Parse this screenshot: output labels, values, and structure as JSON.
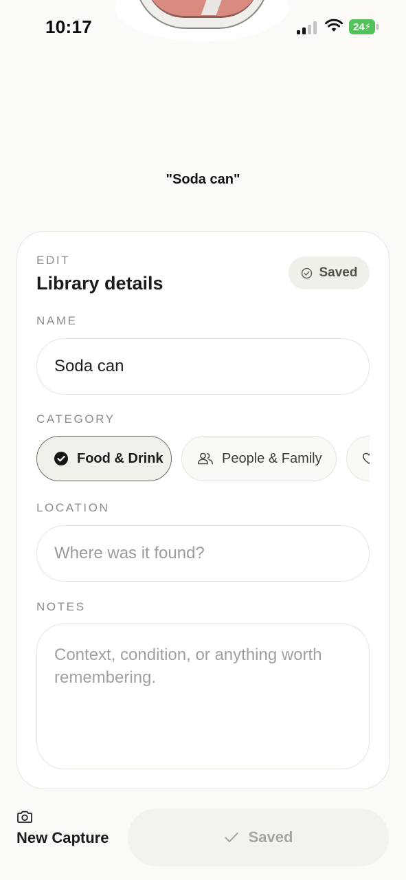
{
  "status_bar": {
    "time": "10:17",
    "battery": "24"
  },
  "capture": {
    "caption": "\"Soda can\""
  },
  "card": {
    "eyebrow": "EDIT",
    "title": "Library details",
    "saved_badge": "Saved",
    "name": {
      "label": "NAME",
      "value": "Soda can"
    },
    "category": {
      "label": "CATEGORY",
      "options": [
        {
          "label": "Food & Drink",
          "icon": "check-circle-icon",
          "selected": true
        },
        {
          "label": "People & Family",
          "icon": "people-icon",
          "selected": false
        },
        {
          "label": "",
          "icon": "heart-icon",
          "selected": false
        }
      ]
    },
    "location": {
      "label": "LOCATION",
      "placeholder": "Where was it found?"
    },
    "notes": {
      "label": "NOTES",
      "placeholder": "Context, condition, or anything worth remembering."
    }
  },
  "bottom_bar": {
    "new_capture_label": "New Capture",
    "save_label": "Saved"
  },
  "colors": {
    "background": "#fbfaf6",
    "battery_green": "#53c25a",
    "text_muted": "#8e8b84"
  }
}
